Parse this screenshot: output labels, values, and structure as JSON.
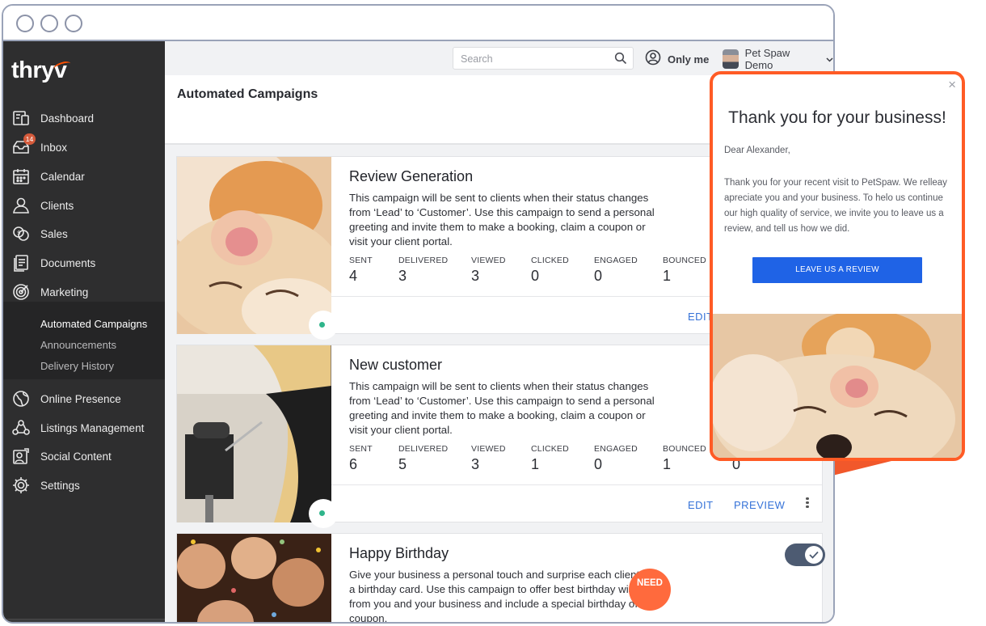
{
  "brand": {
    "logo_text": "thryv",
    "accent": "#ff5000"
  },
  "sidebar": {
    "items": [
      {
        "label": "Dashboard",
        "icon": "dashboard-icon"
      },
      {
        "label": "Inbox",
        "icon": "inbox-icon",
        "badge": "14"
      },
      {
        "label": "Calendar",
        "icon": "calendar-icon"
      },
      {
        "label": "Clients",
        "icon": "clients-icon"
      },
      {
        "label": "Sales",
        "icon": "sales-icon"
      },
      {
        "label": "Documents",
        "icon": "documents-icon"
      },
      {
        "label": "Marketing",
        "icon": "marketing-icon"
      }
    ],
    "subitems": [
      {
        "label": "Automated Campaigns",
        "active": true
      },
      {
        "label": "Announcements"
      },
      {
        "label": "Delivery History"
      }
    ],
    "items_bottom": [
      {
        "label": "Online Presence",
        "icon": "globe-icon"
      },
      {
        "label": "Listings Management",
        "icon": "listings-icon"
      },
      {
        "label": "Social Content",
        "icon": "social-content-icon"
      },
      {
        "label": "Settings",
        "icon": "gear-icon"
      }
    ]
  },
  "topbar": {
    "search_placeholder": "Search",
    "only_me_label": "Only me",
    "user_name": "Pet Spaw Demo"
  },
  "page": {
    "title": "Automated Campaigns"
  },
  "stat_labels": [
    "SENT",
    "DELIVERED",
    "VIEWED",
    "CLICKED",
    "ENGAGED",
    "BOUNCED"
  ],
  "campaigns": [
    {
      "title": "Review Generation",
      "description": "This campaign will be sent to clients when their status changes from ‘Lead’ to ‘Customer’. Use this campaign to send a personal greeting and invite them to make a booking, claim a coupon or visit your client portal.",
      "stats": [
        "4",
        "3",
        "3",
        "0",
        "0",
        "1"
      ],
      "actions": [
        "EDIT"
      ]
    },
    {
      "title": "New customer",
      "description": "This campaign will be sent to clients when their status changes from ‘Lead’ to ‘Customer’. Use this campaign to send a personal greeting and invite them to make a booking, claim a coupon or visit your client portal.",
      "stats": [
        "6",
        "5",
        "3",
        "1",
        "0",
        "1"
      ],
      "extra_stat": "0",
      "actions": [
        "EDIT",
        "PREVIEW"
      ]
    },
    {
      "title": "Happy Birthday",
      "description": "Give your business a personal touch and surprise each client with a birthday card. Use this campaign to offer best birthday wishes from you and your business and include a special birthday offer or coupon."
    }
  ],
  "need_button": "NEED",
  "popup": {
    "title": "Thank you for your business!",
    "greeting": "Dear  Alexander,",
    "body": "Thank you for your recent visit to PetSpaw. We relleay apreciate you and your business. To helo us continue our high quality of service, we invite you to leave us a review, and tell us how we did.",
    "button": "LEAVE US A REVIEW",
    "close": "×"
  },
  "colors": {
    "sidebar_bg": "#2e2e2f",
    "link_blue": "#3572d8",
    "popup_border": "#ff5b25",
    "popup_button": "#1f63e6",
    "status_green": "#2fb58b"
  }
}
